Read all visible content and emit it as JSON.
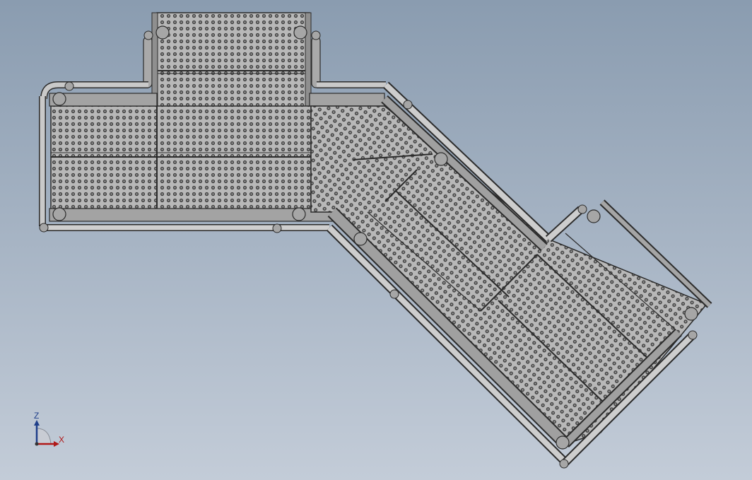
{
  "viewport": {
    "background_top": "#8a9cb0",
    "background_bottom": "#c3ccd8"
  },
  "model": {
    "rail_color": "#9a9a9a",
    "rail_highlight": "#e6e6e6",
    "grating_color": "#b4b4b4",
    "hole_color": "#3a3a3a",
    "outline_color": "#2b2b2b"
  },
  "triad": {
    "z_label": "Z",
    "x_label": "X",
    "z_color": "#1f3f8a",
    "x_color": "#b01818"
  }
}
